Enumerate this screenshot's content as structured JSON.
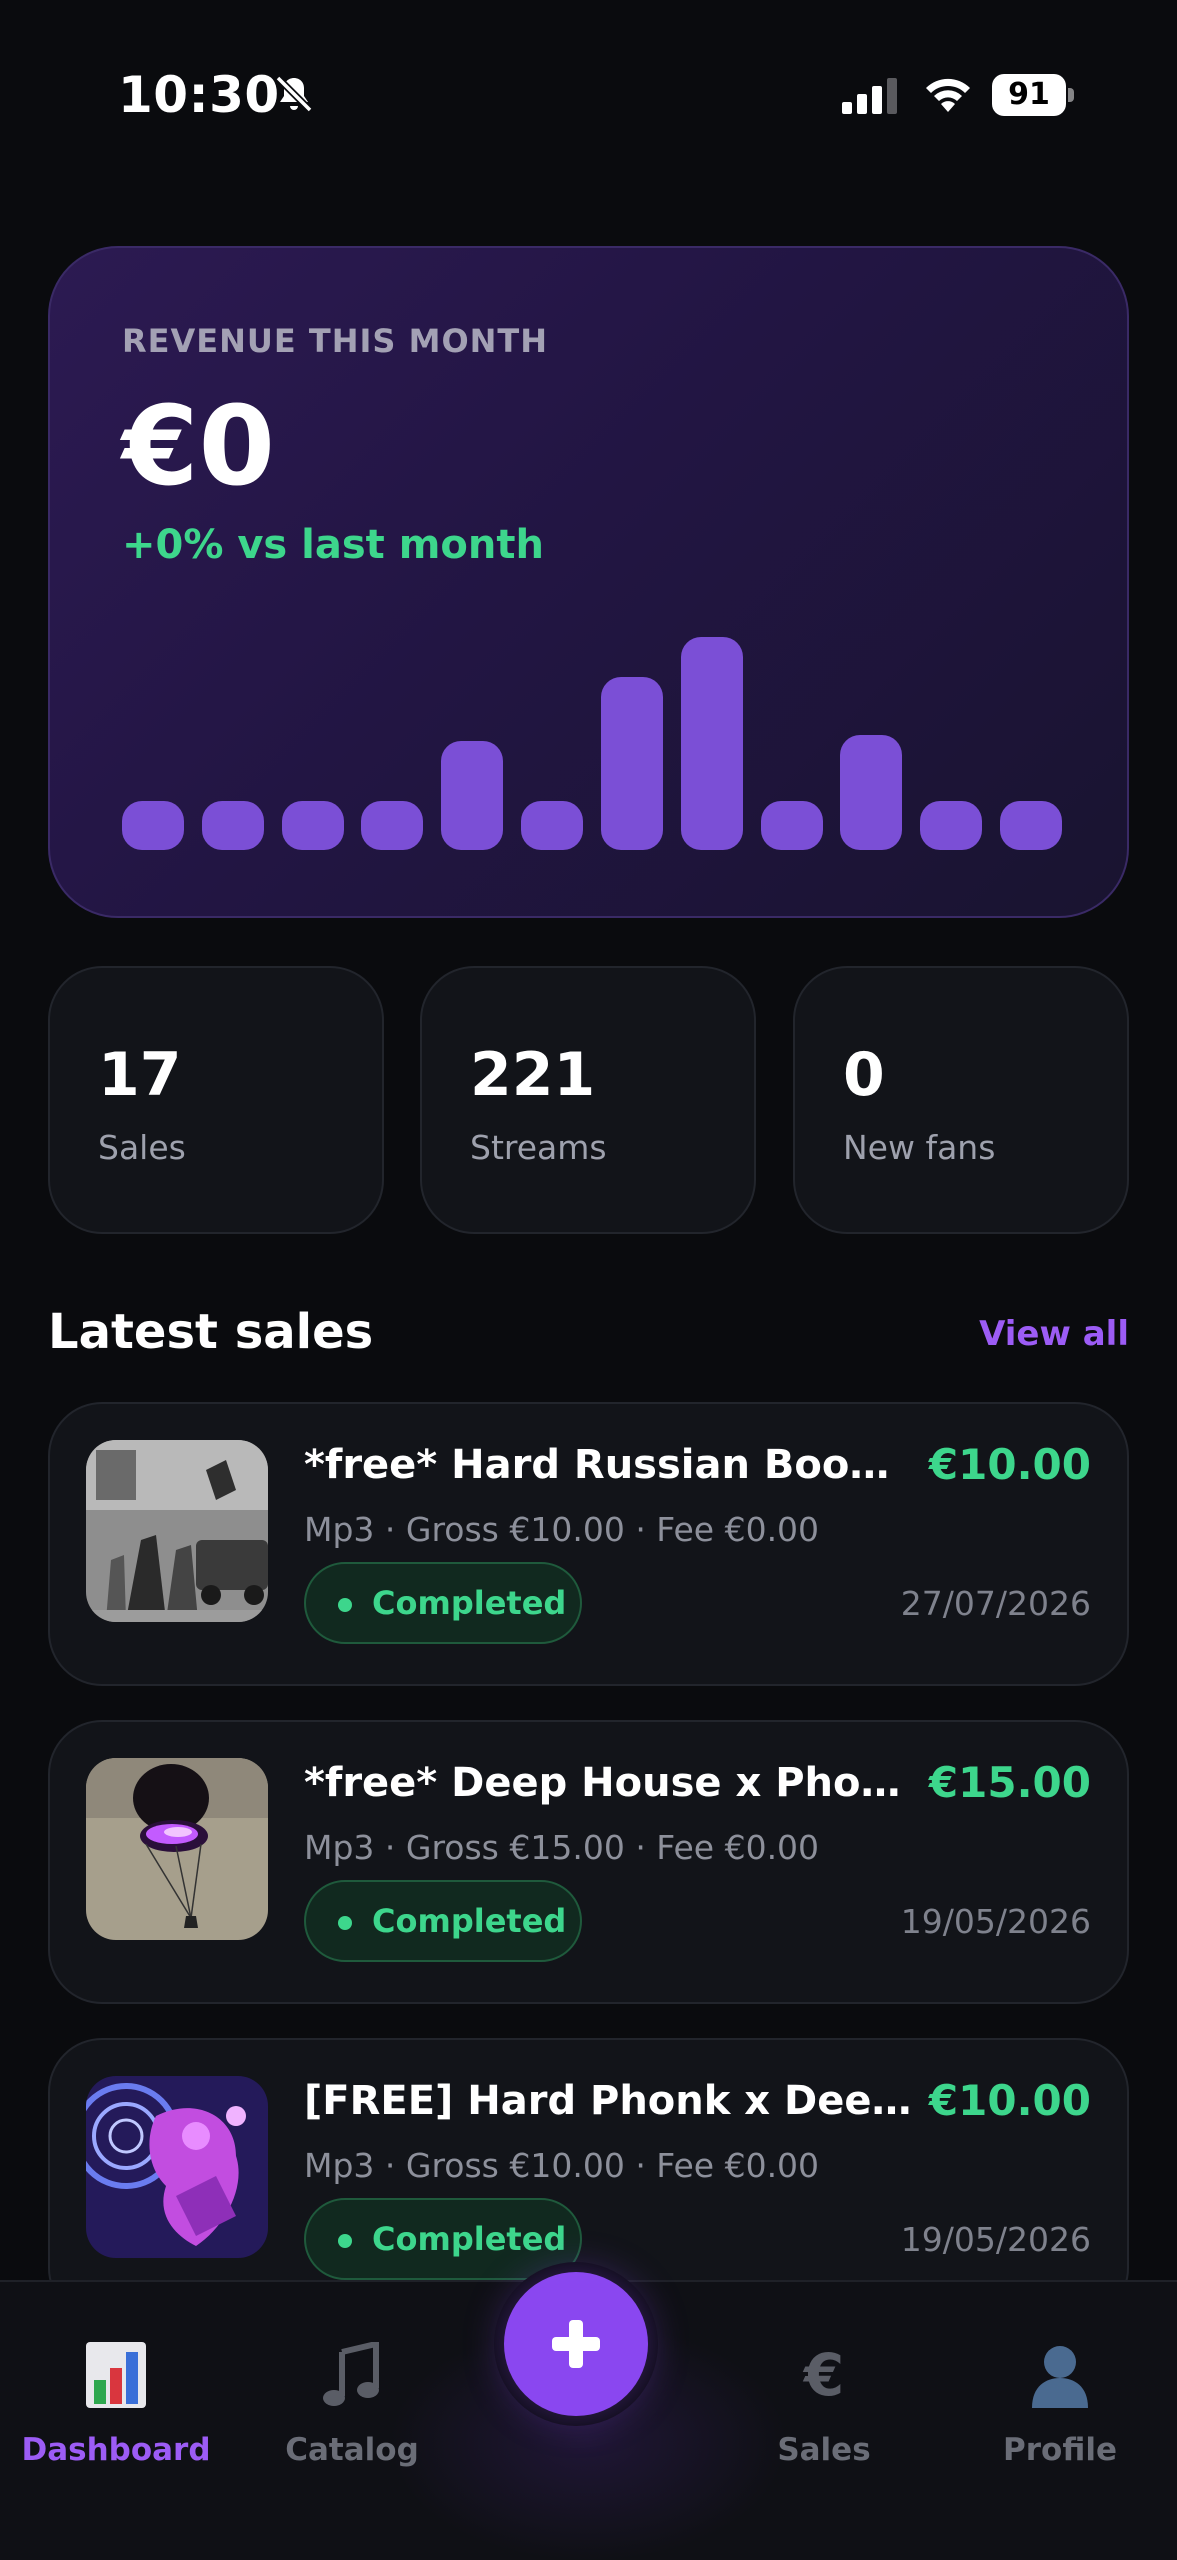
{
  "status_bar": {
    "time": "10:30",
    "battery": "91"
  },
  "revenue": {
    "label": "REVENUE THIS MONTH",
    "value": "€0",
    "change": "+0% vs last month",
    "bar_levels": [
      0.22,
      0.22,
      0.22,
      0.22,
      0.49,
      0.22,
      0.78,
      0.96,
      0.22,
      0.52,
      0.22,
      0.22
    ]
  },
  "stats": [
    {
      "value": "17",
      "label": "Sales"
    },
    {
      "value": "221",
      "label": "Streams"
    },
    {
      "value": "0",
      "label": "New fans"
    }
  ],
  "latest_sales": {
    "title": "Latest sales",
    "view_all": "View all",
    "items": [
      {
        "title": "*free* Hard Russian Boom...",
        "amount": "€10.00",
        "meta": "Mp3 · Gross €10.00 · Fee €0.00",
        "status": "Completed",
        "date": "27/07/2026"
      },
      {
        "title": "*free* Deep House x Phon...",
        "amount": "€15.00",
        "meta": "Mp3 · Gross €15.00 · Fee €0.00",
        "status": "Completed",
        "date": "19/05/2026"
      },
      {
        "title": "[FREE] Hard Phonk x Deep...",
        "amount": "€10.00",
        "meta": "Mp3 · Gross €10.00 · Fee €0.00",
        "status": "Completed",
        "date": "19/05/2026"
      }
    ]
  },
  "tabs": [
    {
      "label": "Dashboard",
      "icon": "bar-chart-icon",
      "active": true
    },
    {
      "label": "Catalog",
      "icon": "music-note-icon",
      "active": false
    },
    {
      "label": "Sales",
      "icon": "euro-icon",
      "active": false
    },
    {
      "label": "Profile",
      "icon": "person-icon",
      "active": false
    }
  ],
  "colors": {
    "accent": "#8a47f0",
    "positive": "#3dd68c",
    "background": "#0a0b0e"
  }
}
